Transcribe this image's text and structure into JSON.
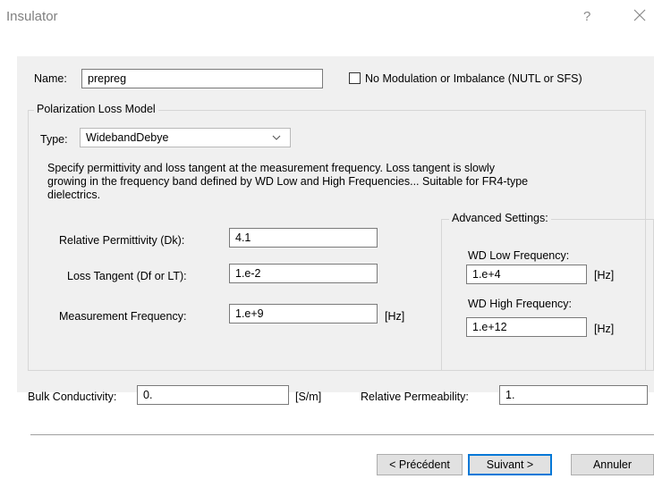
{
  "window": {
    "title": "Insulator",
    "help_glyph": "?"
  },
  "name_field": {
    "label": "Name:",
    "value": "prepreg"
  },
  "no_modulation": {
    "label": "No Modulation or Imbalance (NUTL or SFS)",
    "checked": false
  },
  "polarization": {
    "group_title": "Polarization Loss Model",
    "type_label": "Type:",
    "type_value": "WidebandDebye",
    "description_lines": [
      "Specify permittivity and loss tangent at the measurement frequency. Loss tangent is slowly",
      "growing in the frequency band defined by WD Low and High Frequencies... Suitable for FR4-type",
      "dielectrics."
    ],
    "relative_permittivity": {
      "label": "Relative Permittivity (Dk):",
      "value": "4.1"
    },
    "loss_tangent": {
      "label": "Loss Tangent (Df or LT):",
      "value": "1.e-2"
    },
    "measurement_frequency": {
      "label": "Measurement Frequency:",
      "value": "1.e+9",
      "unit": "[Hz]"
    },
    "advanced": {
      "title": "Advanced Settings:",
      "wd_low": {
        "label": "WD Low Frequency:",
        "value": "1.e+4",
        "unit": "[Hz]"
      },
      "wd_high": {
        "label": "WD High Frequency:",
        "value": "1.e+12",
        "unit": "[Hz]"
      }
    }
  },
  "bulk_conductivity": {
    "label": "Bulk Conductivity:",
    "value": "0.",
    "unit": "[S/m]"
  },
  "relative_permeability": {
    "label": "Relative Permeability:",
    "value": "1."
  },
  "buttons": {
    "previous": "< Précédent",
    "next": "Suivant >",
    "cancel": "Annuler"
  }
}
